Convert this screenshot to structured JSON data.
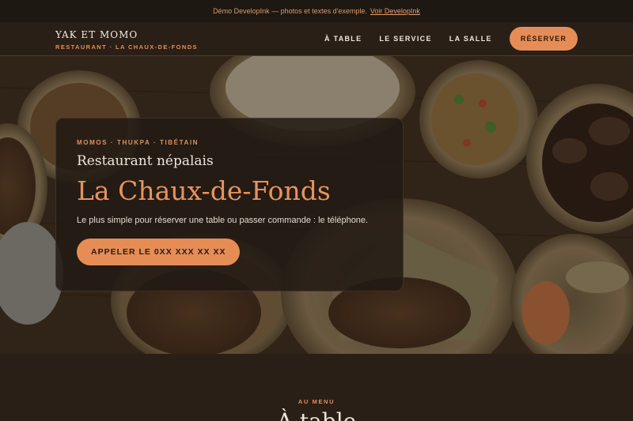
{
  "demo_bar": {
    "text": "Démo DevelopInk — photos et textes d'exemple.",
    "link": "Voir DevelopInk"
  },
  "brand": {
    "name": "YAK ET MOMO",
    "subtitle": "RESTAURANT · LA CHAUX-DE-FONDS"
  },
  "nav": {
    "links": [
      "À TABLE",
      "LE SERVICE",
      "LA SALLE"
    ],
    "cta": "RÉSERVER"
  },
  "hero": {
    "eyebrow": "MOMOS · THUKPA · TIBÉTAIN",
    "subtitle": "Restaurant népalais",
    "title": "La Chaux-de-Fonds",
    "text": "Le plus simple pour réserver une table ou passer commande : le téléphone.",
    "cta": "APPELER LE 0XX XXX XX XX"
  },
  "menu": {
    "eyebrow": "AU MENU",
    "title": "À table"
  },
  "colors": {
    "accent": "#e68d56",
    "background": "#2a1f17"
  }
}
